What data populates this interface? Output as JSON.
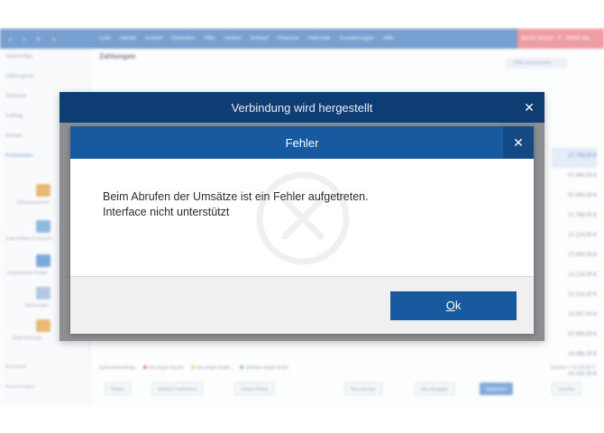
{
  "background_app": {
    "nav_glyphs": [
      "‹",
      "›",
      "+",
      "⌕"
    ],
    "menu": [
      "Liste",
      "Aktuell",
      "Ansicht",
      "Einstellen",
      "Hilfe",
      "Umlauf",
      "Einkauf",
      "Finanzen",
      "Intervalle",
      "Auswertungen",
      "Hilfe"
    ],
    "user_badge": "Bernd Schulz · 0 · 00000 Ba...",
    "toolbar_title": "Zahlungen",
    "filter_pill": "Filter zurücksetzen",
    "sidebar_items": [
      "Sammeltyp",
      "Zahlungsart",
      "Zeitraum",
      "Auftrag",
      "Konten",
      "Kontodaten"
    ],
    "sidebar_caps": [
      "Zahlungsverkehr",
      "Lastschriften & Gutschr.",
      "Umgebuchte Posten",
      "Mahnungen",
      "Bank-Auszüge"
    ],
    "right_values": [
      "17.789,00 €",
      "57.890,00 €",
      "57.890,00 €",
      "21.789,00 €",
      "22.214,00 €",
      "27.894,00 €",
      "22.214,00 €",
      "22.214,00 €",
      "23.567,00 €",
      "57.890,00 €",
      "24.456,00 €",
      "40.231,00 €"
    ],
    "status_left": "Sperrverwendung",
    "status_dots": [
      {
        "label": "mit wegen Grund",
        "color": "#e05454"
      },
      {
        "label": "bei wegen bearb.",
        "color": "#e8c84a"
      },
      {
        "label": "Sichtbar wegen Ende",
        "color": "#58b85c"
      }
    ],
    "status_right": "Summe = 75.678,90 €",
    "lower_left_labels": [
      "Buchstelle",
      "Auswertungen"
    ],
    "bottom_buttons": [
      "Details",
      "Weitere Funktionen",
      "Umlauf-Detail",
      "Neu Umsatz",
      "Neu Ausgabe",
      "Speichern",
      "Löschen"
    ]
  },
  "outer_dialog": {
    "title": "Verbindung wird hergestellt",
    "close_glyph": "✕"
  },
  "error_dialog": {
    "title": "Fehler",
    "close_glyph": "✕",
    "message_line1": "Beim Abrufen der Umsätze ist ein Fehler aufgetreten.",
    "message_line2": "Interface nicht unterstützt",
    "ok_label_underlined": "O",
    "ok_label_rest": "k",
    "watermark_icon": "circle-x-icon"
  },
  "colors": {
    "outer_header": "#0e3d74",
    "inner_header": "#175a9f",
    "ok_button": "#175a9f"
  }
}
